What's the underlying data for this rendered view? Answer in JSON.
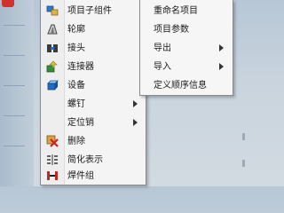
{
  "colors": {
    "menu_bg": "#f4f4f4",
    "menu_border": "#8a8a8a",
    "background": "#c9d4de"
  },
  "context_menu": {
    "items": [
      {
        "label": "项目子组件",
        "icon": "subassembly-icon",
        "has_submenu": false
      },
      {
        "label": "轮廓",
        "icon": "profile-icon",
        "has_submenu": false
      },
      {
        "label": "接头",
        "icon": "joint-icon",
        "has_submenu": false
      },
      {
        "label": "连接器",
        "icon": "connector-icon",
        "has_submenu": false
      },
      {
        "label": "设备",
        "icon": "device-icon",
        "has_submenu": false
      },
      {
        "label": "螺钉",
        "icon": "",
        "has_submenu": true
      },
      {
        "label": "定位销",
        "icon": "",
        "has_submenu": true
      },
      {
        "label": "删除",
        "icon": "delete-icon",
        "has_submenu": false
      },
      {
        "label": "简化表示",
        "icon": "simplified-representation-icon",
        "has_submenu": false
      },
      {
        "label": "焊件组",
        "icon": "weldment-group-icon",
        "has_submenu": false
      }
    ]
  },
  "submenu": {
    "items": [
      {
        "label": "重命名项目",
        "has_submenu": false
      },
      {
        "label": "项目参数",
        "has_submenu": false
      },
      {
        "label": "导出",
        "has_submenu": true
      },
      {
        "label": "导入",
        "has_submenu": true
      },
      {
        "label": "定义顺序信息",
        "has_submenu": false
      }
    ]
  }
}
